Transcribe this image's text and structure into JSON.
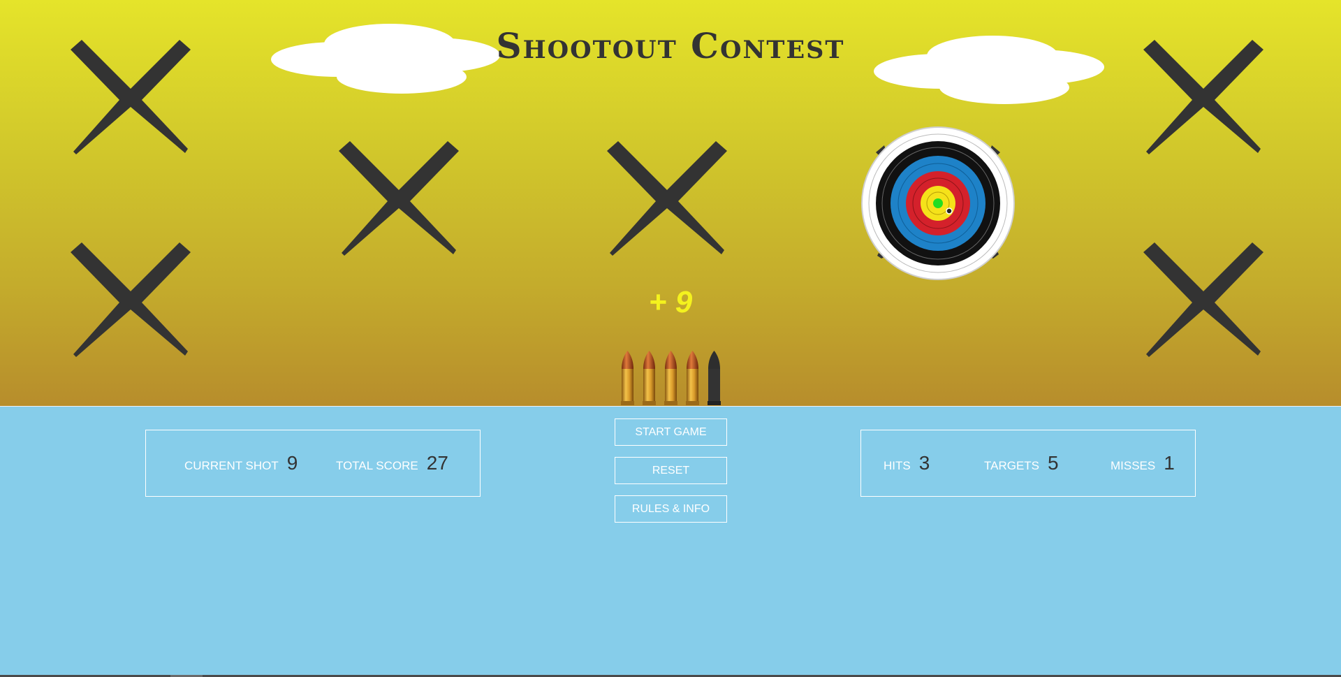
{
  "game": {
    "title": "Shootout Contest",
    "last_shot_display": "+ 9",
    "targets": [
      {
        "id": "target-top-left",
        "state": "missed",
        "icon": "x-mark-icon"
      },
      {
        "id": "target-bottom-left",
        "state": "missed",
        "icon": "x-mark-icon"
      },
      {
        "id": "target-middle-left",
        "state": "missed",
        "icon": "x-mark-icon"
      },
      {
        "id": "target-middle-center",
        "state": "missed",
        "icon": "x-mark-icon"
      },
      {
        "id": "target-archery",
        "state": "active",
        "icon": "archery-target-icon"
      },
      {
        "id": "target-top-right",
        "state": "missed",
        "icon": "x-mark-icon"
      },
      {
        "id": "target-bottom-right",
        "state": "missed",
        "icon": "x-mark-icon"
      }
    ],
    "ammo": {
      "total": 5,
      "remaining": 4,
      "loaded_icon": "bullet-icon",
      "spent_icon": "spent-bullet-icon"
    }
  },
  "stats_left": {
    "current_shot_label": "CURRENT SHOT",
    "current_shot_value": "9",
    "total_score_label": "TOTAL SCORE",
    "total_score_value": "27"
  },
  "stats_right": {
    "hits_label": "HITS",
    "hits_value": "3",
    "targets_label": "TARGETS",
    "targets_value": "5",
    "misses_label": "MISSES",
    "misses_value": "1"
  },
  "buttons": {
    "start": "START GAME",
    "reset": "RESET",
    "rules": "RULES & INFO"
  },
  "colors": {
    "sky_top": "#e5e42a",
    "sky_bottom": "#b78d2c",
    "hud_background": "#86cdea",
    "x_mark": "#333333",
    "score_popup": "#f4f21e",
    "bullseye_center": "#22dd22"
  }
}
